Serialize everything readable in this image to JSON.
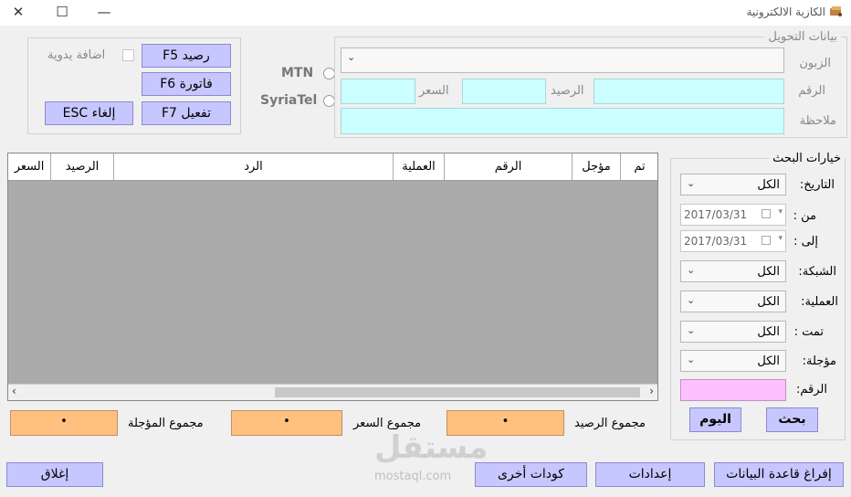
{
  "window": {
    "title": "الكازية الالكترونية"
  },
  "transfer": {
    "legend": "بيانات التحويل",
    "customer_label": "الزبون",
    "number_label": "الرقم",
    "balance_label": "الرصيد",
    "price_label": "السعر",
    "note_label": "ملاحظة"
  },
  "networks": {
    "mtn": "MTN",
    "syriatel": "SyriaTel"
  },
  "buttons": {
    "balance": "رصيد F5",
    "invoice": "فاتورة F6",
    "activate": "تفعيل F7",
    "cancel": "إلغاء ESC",
    "manual_add": "اضافة يدوية",
    "today": "اليوم",
    "search": "بحث",
    "close": "إغلاق",
    "other_codes": "كودات أخرى",
    "settings": "إعدادات",
    "empty_db": "إفراغ قاعدة البيانات"
  },
  "grid": {
    "columns": [
      "تم",
      "مؤجل",
      "الرقم",
      "العملية",
      "الرد",
      "الرصيد",
      "السعر"
    ]
  },
  "search": {
    "legend": "خيارات البحث",
    "date_label": "التاريخ:",
    "date_value": "الكل",
    "from_label": "من :",
    "from_value": "2017/03/31",
    "to_label": "إلى :",
    "to_value": "2017/03/31",
    "network_label": "الشبكة:",
    "network_value": "الكل",
    "operation_label": "العملية:",
    "operation_value": "الكل",
    "done_label": "تمت :",
    "done_value": "الكل",
    "deferred_label": "مؤجلة:",
    "deferred_value": "الكل",
    "number_label": "الرقم:"
  },
  "totals": {
    "deferred_label": "مجموع المؤجلة",
    "deferred_value": "•",
    "price_label": "مجموع السعر",
    "price_value": "•",
    "balance_label": "مجموع الرصيد",
    "balance_value": "•"
  },
  "watermark": {
    "arabic": "مستقل",
    "latin": "mostaql.com"
  }
}
